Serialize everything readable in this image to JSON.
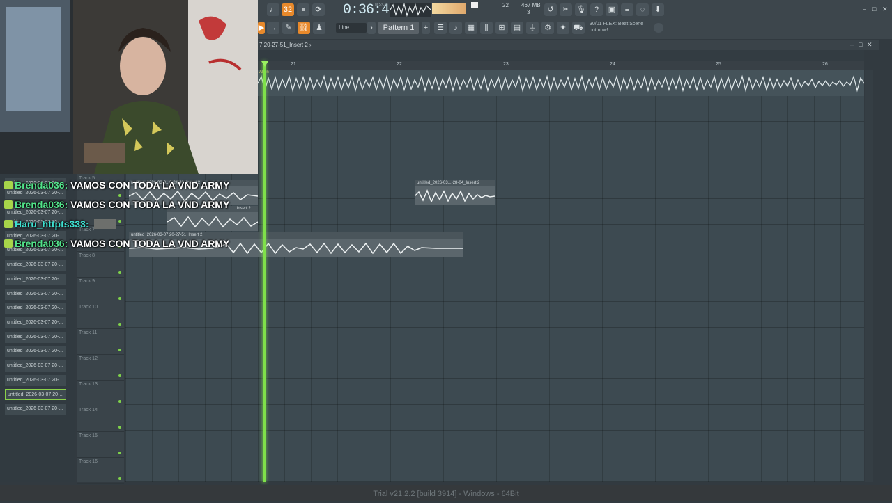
{
  "transport": {
    "time": "0:36:46",
    "time_units": "M:S:CS",
    "bpm": "32",
    "cpu": "22",
    "memory": "467 MB",
    "polyphony": "3",
    "snap": "Line",
    "pattern": "Pattern 1",
    "news_line1": "30/01 FLEX: Beat Scene",
    "news_line2": "out now!"
  },
  "playlist": {
    "title": "7 20-27-51_Insert 2 ›",
    "ruler": [
      "21",
      "22",
      "23",
      "24",
      "25",
      "26"
    ],
    "track1_label": "Akon",
    "clips": [
      {
        "title": "untitled_2026-03...-28-04_Insert 2"
      },
      {
        "title": "untitled_2026-03-0...0-24-40_Insert 2"
      },
      {
        "title": "...insert 2"
      },
      {
        "title": "untitled_2026-03-07 20-27-51_Insert 2"
      }
    ],
    "tracks": [
      "Track 5",
      "Track 6",
      "Track 7",
      "Track 8",
      "Track 9",
      "Track 10",
      "Track 11",
      "Track 12",
      "Track 13",
      "Track 14",
      "Track 15",
      "Track 16"
    ]
  },
  "browser": {
    "items": [
      "untitled_2026-03-07 20-...",
      "untitled_2026-03-07 20-...",
      "untitled_2026-03-07 20-...",
      "untitled_2026-03-07 20-...",
      "untitled_2026-03-07 20-...",
      "untitled_2026-03-07 20-...",
      "untitled_2026-03-07 20-...",
      "untitled_2026-03-07 20-...",
      "untitled_2026-03-07 20-...",
      "untitled_2026-03-07 20-...",
      "untitled_2026-03-07 20-...",
      "untitled_2026-03-07 20-...",
      "untitled_2026-03-07 20-...",
      "untitled_2026-03-07 20-...",
      "untitled_2026-03-07 20-...",
      "untitled_2026-03-07 20-...",
      "untitled_2026-03-07 20-..."
    ]
  },
  "chat": [
    {
      "user": "Brenda036:",
      "message": "VAMOS CON TODA LA VND ARMY"
    },
    {
      "user": "Brenda036:",
      "message": "VAMOS CON TODA LA VND ARMY"
    },
    {
      "user": "Haru_httpts333:",
      "message": ""
    },
    {
      "user": "Brenda036:",
      "message": "VAMOS CON TODA LA VND ARMY"
    }
  ],
  "status": {
    "text": "Trial v21.2.2 [build 3914] - Windows - 64Bit"
  },
  "colors": {
    "accent": "#e8892b",
    "playhead": "#7fe04a",
    "background": "#323a40"
  }
}
